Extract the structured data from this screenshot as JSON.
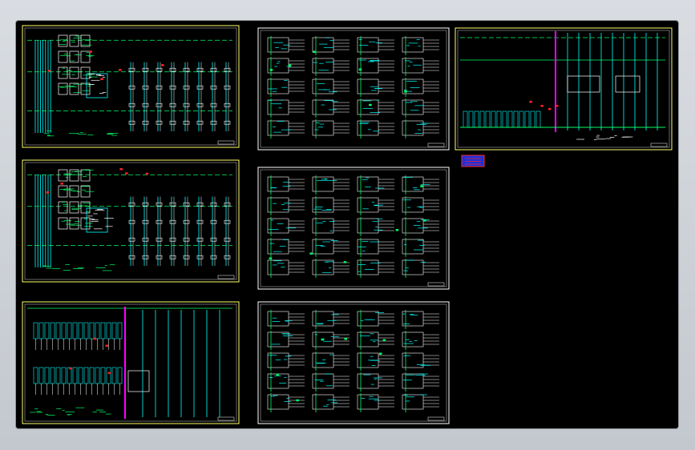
{
  "viewer": {
    "background": "#000000",
    "frame_color": "#cfd3d8"
  },
  "colors": {
    "border": "#ffff66",
    "inner_border": "#ffffff",
    "wire": "#00ffff",
    "accent": "#00ff66",
    "bus": "#ff00ff",
    "tag": "#ff2222",
    "text": "#ffffff"
  },
  "sheets": [
    {
      "id": "sheet-1",
      "style": "riser",
      "border": "yellow"
    },
    {
      "id": "sheet-2",
      "style": "riser",
      "border": "yellow"
    },
    {
      "id": "sheet-3",
      "style": "panel",
      "border": "yellow"
    },
    {
      "id": "sheet-4",
      "style": "schedule",
      "border": "white"
    },
    {
      "id": "sheet-5",
      "style": "schedule",
      "border": "white"
    },
    {
      "id": "sheet-6",
      "style": "schedule",
      "border": "white"
    },
    {
      "id": "sheet-7",
      "style": "overview",
      "border": "yellow"
    }
  ],
  "legend_block": {
    "fill": "#1e2fd8",
    "outline": "#ff2a2a"
  }
}
